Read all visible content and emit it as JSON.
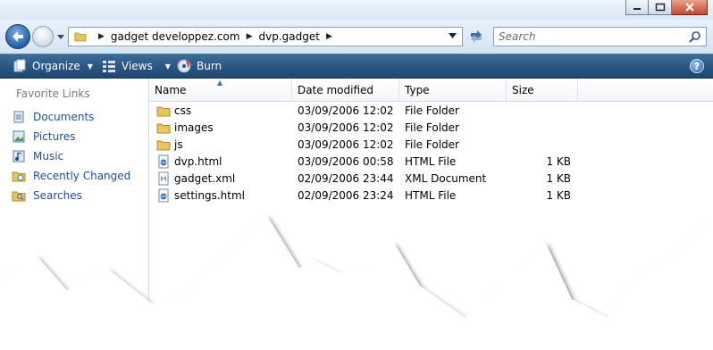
{
  "window": {
    "controls": {
      "minimize_icon": "minimize-icon",
      "maximize_icon": "maximize-icon",
      "close_icon": "close-icon"
    }
  },
  "address_bar": {
    "breadcrumbs": [
      "gadget developpez.com",
      "dvp.gadget"
    ]
  },
  "search": {
    "placeholder": "Search"
  },
  "command_bar": {
    "organize": "Organize",
    "views": "Views",
    "burn": "Burn",
    "help": "?"
  },
  "nav_pane": {
    "header": "Favorite Links",
    "links": [
      "Documents",
      "Pictures",
      "Music",
      "Recently Changed",
      "Searches"
    ]
  },
  "file_list": {
    "columns": [
      "Name",
      "Date modified",
      "Type",
      "Size"
    ],
    "rows": [
      {
        "name": "css",
        "date": "03/09/2006 12:02",
        "type": "File Folder",
        "size": "",
        "icon": "folder-icon"
      },
      {
        "name": "images",
        "date": "03/09/2006 12:02",
        "type": "File Folder",
        "size": "",
        "icon": "folder-icon"
      },
      {
        "name": "js",
        "date": "03/09/2006 12:02",
        "type": "File Folder",
        "size": "",
        "icon": "folder-icon"
      },
      {
        "name": "dvp.html",
        "date": "03/09/2006 00:58",
        "type": "HTML File",
        "size": "1 KB",
        "icon": "html-file-icon"
      },
      {
        "name": "gadget.xml",
        "date": "02/09/2006 23:44",
        "type": "XML Document",
        "size": "1 KB",
        "icon": "xml-file-icon"
      },
      {
        "name": "settings.html",
        "date": "02/09/2006 23:24",
        "type": "HTML File",
        "size": "1 KB",
        "icon": "html-file-icon"
      }
    ]
  },
  "colors": {
    "command_bar": "#2a5582",
    "link_text": "#1c4f9a",
    "close_button": "#c8452d"
  }
}
